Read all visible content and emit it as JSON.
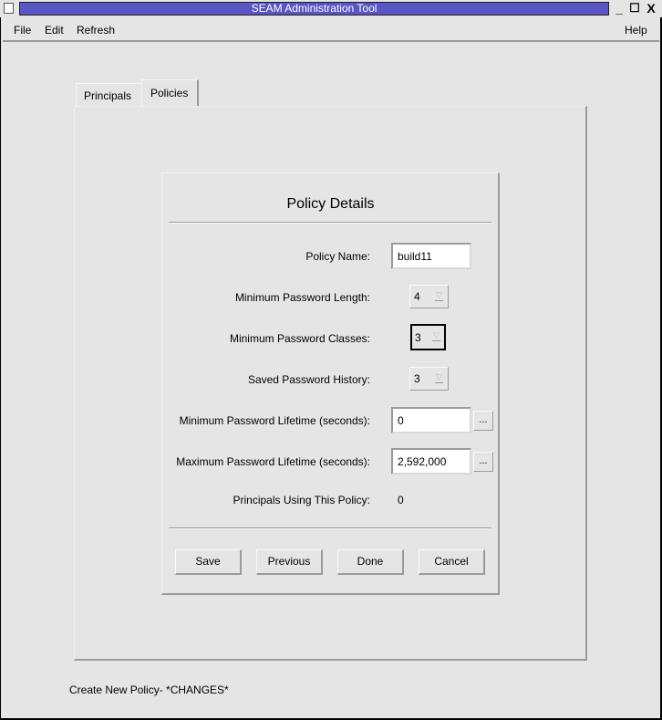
{
  "window": {
    "title": "SEAM Administration Tool",
    "controls": {
      "minimize": "_",
      "maximize": "☐",
      "close": "X"
    }
  },
  "menubar": {
    "items": [
      {
        "label": "File"
      },
      {
        "label": "Edit"
      },
      {
        "label": "Refresh"
      }
    ],
    "help": "Help"
  },
  "tabs": [
    {
      "label": "Principals",
      "selected": false
    },
    {
      "label": "Policies",
      "selected": true
    }
  ],
  "dialog": {
    "title": "Policy Details",
    "fields": {
      "policy_name": {
        "label": "Policy Name:",
        "value": "build11"
      },
      "min_password_length": {
        "label": "Minimum Password Length:",
        "value": "4"
      },
      "min_password_classes": {
        "label": "Minimum Password Classes:",
        "value": "3"
      },
      "saved_password_history": {
        "label": "Saved Password History:",
        "value": "3"
      },
      "min_password_lifetime": {
        "label": "Minimum Password Lifetime (seconds):",
        "value": "0",
        "button": "..."
      },
      "max_password_lifetime": {
        "label": "Maximum Password Lifetime (seconds):",
        "value": "2,592,000",
        "button": "..."
      },
      "principals_using": {
        "label": "Principals Using This Policy:",
        "value": "0"
      }
    },
    "buttons": {
      "save": "Save",
      "previous": "Previous",
      "done": "Done",
      "cancel": "Cancel"
    }
  },
  "status": "Create New Policy- *CHANGES*"
}
